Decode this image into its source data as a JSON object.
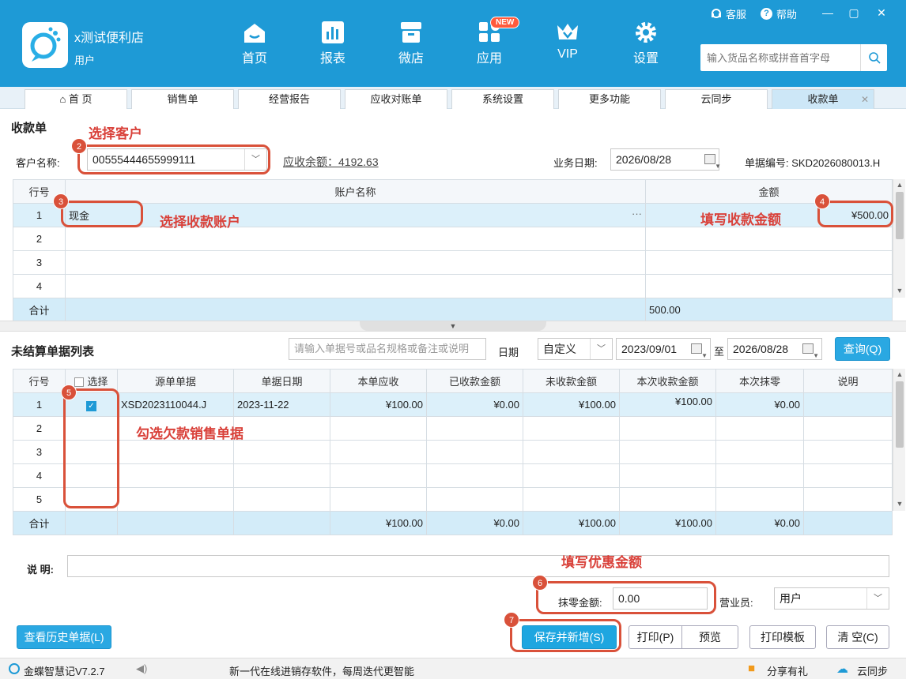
{
  "header": {
    "store_name": "x测试便利店",
    "role": "用户",
    "nav": [
      {
        "label": "首页",
        "icon": "home-icon"
      },
      {
        "label": "报表",
        "icon": "report-chart-icon"
      },
      {
        "label": "微店",
        "icon": "shop-icon"
      },
      {
        "label": "应用",
        "icon": "apps-grid-icon"
      },
      {
        "label": "VIP",
        "icon": "vip-crown-icon"
      },
      {
        "label": "设置",
        "icon": "gear-icon"
      }
    ],
    "new_badge": "NEW",
    "service_label": "客服",
    "help_label": "帮助",
    "search_placeholder": "输入货品名称或拼音首字母"
  },
  "tabs": [
    "首 页",
    "销售单",
    "经营报告",
    "应收对账单",
    "系统设置",
    "更多功能",
    "云同步",
    "收款单"
  ],
  "receipt": {
    "title": "收款单",
    "customer_label": "客户名称:",
    "customer_value": "00555444655999111",
    "receivable_link": "应收余额：4192.63",
    "date_label": "业务日期:",
    "date_value": "2026/08/28",
    "doc_no": "单据编号: SKD2026080013.H",
    "table": {
      "headers": [
        "行号",
        "账户名称",
        "金额"
      ],
      "rows": [
        {
          "no": "1",
          "account": "现金",
          "more": "···",
          "amount": "¥500.00"
        },
        {
          "no": "2",
          "account": "",
          "more": "",
          "amount": ""
        },
        {
          "no": "3",
          "account": "",
          "more": "",
          "amount": ""
        },
        {
          "no": "4",
          "account": "",
          "more": "",
          "amount": ""
        }
      ],
      "total_label": "合计",
      "total_amount": "500.00"
    }
  },
  "unsettled": {
    "title": "未结算单据列表",
    "filter_placeholder": "请输入单据号或品名规格或备注或说明",
    "date_label": "日期",
    "range_value": "自定义",
    "start_date": "2023/09/01",
    "to_label": "至",
    "end_date": "2026/08/28",
    "query_button": "查询(Q)",
    "headers": [
      "行号",
      "选择",
      "源单单据",
      "单据日期",
      "本单应收",
      "已收款金额",
      "未收款金额",
      "本次收款金额",
      "本次抹零",
      "说明"
    ],
    "rows": [
      {
        "no": "1",
        "doc": "XSD2023110044.J",
        "date": "2023-11-22",
        "receivable": "¥100.00",
        "received": "¥0.00",
        "unreceived": "¥100.00",
        "this_amount": "¥100.00",
        "rounding": "¥0.00",
        "note": ""
      },
      {
        "no": "2",
        "doc": "",
        "date": "",
        "receivable": "",
        "received": "",
        "unreceived": "",
        "this_amount": "",
        "rounding": "",
        "note": ""
      },
      {
        "no": "3",
        "doc": "",
        "date": "",
        "receivable": "",
        "received": "",
        "unreceived": "",
        "this_amount": "",
        "rounding": "",
        "note": ""
      },
      {
        "no": "4",
        "doc": "",
        "date": "",
        "receivable": "",
        "received": "",
        "unreceived": "",
        "this_amount": "",
        "rounding": "",
        "note": ""
      },
      {
        "no": "5",
        "doc": "",
        "date": "",
        "receivable": "",
        "received": "",
        "unreceived": "",
        "this_amount": "",
        "rounding": "",
        "note": ""
      }
    ],
    "total": {
      "label": "合计",
      "receivable": "¥100.00",
      "received": "¥0.00",
      "unreceived": "¥100.00",
      "this_amount": "¥100.00",
      "rounding": "¥0.00"
    }
  },
  "footer": {
    "note_label": "说 明:",
    "discount_label": "抹零金额:",
    "discount_value": "0.00",
    "salesman_label": "营业员:",
    "salesman_value": "用户",
    "history_button": "查看历史单据(L)",
    "save_button": "保存并新增(S)",
    "print_button": "打印(P)",
    "preview_button": "预览",
    "template_button": "打印模板",
    "clear_button": "清 空(C)"
  },
  "annotations": {
    "a2": "选择客户",
    "a3": "选择收款账户",
    "a4": "填写收款金额",
    "a5": "勾选欠款销售单据",
    "a6": "填写优惠金额",
    "n2": "2",
    "n3": "3",
    "n4": "4",
    "n5": "5",
    "n6": "6",
    "n7": "7"
  },
  "status": {
    "version": "金蝶智慧记V7.2.7",
    "slogan": "新一代在线进销存软件，每周迭代更智能",
    "share": "分享有礼",
    "sync": "云同步"
  },
  "colors": {
    "header": "#1e9ad6",
    "annotation": "#d9513a",
    "primary": "#1ea6e0"
  }
}
